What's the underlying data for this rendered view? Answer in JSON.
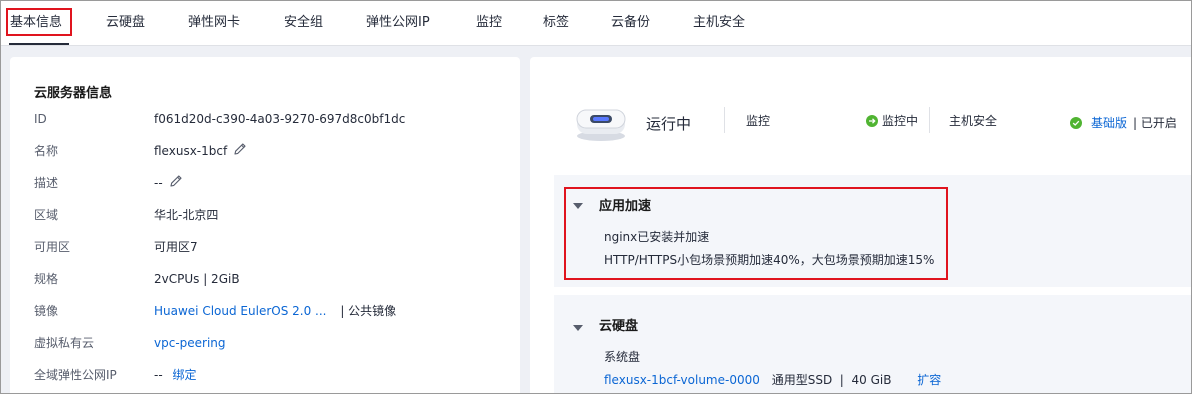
{
  "tabs": [
    {
      "label": "基本信息",
      "active": true
    },
    {
      "label": "云硬盘"
    },
    {
      "label": "弹性网卡"
    },
    {
      "label": "安全组"
    },
    {
      "label": "弹性公网IP"
    },
    {
      "label": "监控"
    },
    {
      "label": "标签"
    },
    {
      "label": "云备份"
    },
    {
      "label": "主机安全"
    }
  ],
  "server_info": {
    "title": "云服务器信息",
    "rows": [
      {
        "label": "ID",
        "value": "f061d20d-c390-4a03-9270-697d8c0bf1dc"
      },
      {
        "label": "名称",
        "value": "flexusx-1bcf"
      },
      {
        "label": "描述",
        "value": "--"
      },
      {
        "label": "区域",
        "value": "华北-北京四"
      },
      {
        "label": "可用区",
        "value": "可用区7"
      },
      {
        "label": "规格",
        "value": "2vCPUs | 2GiB"
      },
      {
        "label": "镜像",
        "value": "Huawei Cloud EulerOS 2.0 ...",
        "suffix": "| 公共镜像"
      },
      {
        "label": "虚拟私有云",
        "value": "vpc-peering"
      },
      {
        "label": "全域弹性公网IP",
        "value": "--",
        "action": "绑定"
      }
    ]
  },
  "status": {
    "state": "运行中",
    "monitor_label": "监控",
    "monitor_status": "监控中",
    "host_security_label": "主机安全",
    "edition": "基础版",
    "edition_status": "| 已开启"
  },
  "acceleration": {
    "title": "应用加速",
    "line1": "nginx已安装并加速",
    "line2": "HTTP/HTTPS小包场景预期加速40%，大包场景预期加速15%"
  },
  "disk": {
    "title": "云硬盘",
    "system_disk_label": "系统盘",
    "volume_name": "flexusx-1bcf-volume-0000",
    "volume_info": "通用型SSD  |  40 GiB",
    "expand": "扩容"
  },
  "colors": {
    "accent": "#0b66d4",
    "highlight_red": "#e0141e",
    "success_green": "#50b432"
  }
}
